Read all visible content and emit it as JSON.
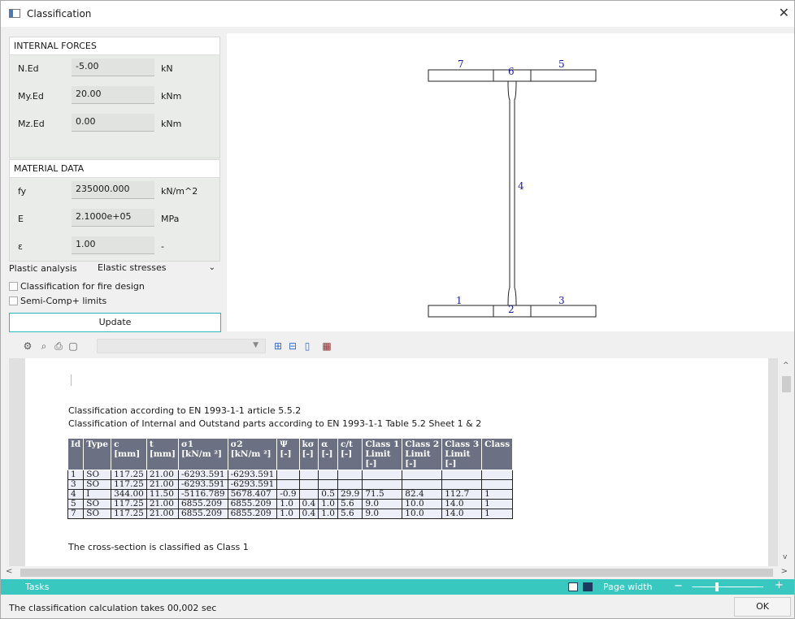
{
  "window": {
    "title": "Classification"
  },
  "forces": {
    "header": "INTERNAL FORCES",
    "rows": [
      {
        "label": "N.Ed",
        "value": "-5.00",
        "unit": "kN"
      },
      {
        "label": "My.Ed",
        "value": "20.00",
        "unit": "kNm"
      },
      {
        "label": "Mz.Ed",
        "value": "0.00",
        "unit": "kNm"
      }
    ]
  },
  "material": {
    "header": "MATERIAL DATA",
    "rows": [
      {
        "label": "fy",
        "value": "235000.000",
        "unit": "kN/m^2"
      },
      {
        "label": "E",
        "value": "2.1000e+05",
        "unit": "MPa"
      },
      {
        "label": "ε",
        "value": "1.00",
        "unit": "-"
      }
    ]
  },
  "plastic": {
    "label": "Plastic analysis",
    "value": "Elastic stresses"
  },
  "checks": {
    "fire": "Classification for fire design",
    "semi": "Semi-Comp+ limits"
  },
  "update_label": "Update",
  "diagram": {
    "labels": [
      "7",
      "6",
      "5",
      "4",
      "1",
      "2",
      "3"
    ]
  },
  "report": {
    "line1": "Classification  according to EN 1993-1-1 article 5.5.2",
    "line2": "Classification  of Internal and Outstand parts according to EN 1993-1-1 Table 5.2 Sheet 1 & 2",
    "conclusion": "The cross-section is classified  as Class 1",
    "headers": [
      [
        "Id"
      ],
      [
        "Type"
      ],
      [
        "c",
        "[mm]"
      ],
      [
        "t",
        "[mm]"
      ],
      [
        "σ1",
        "[kN/m ²]"
      ],
      [
        "σ2",
        "[kN/m ²]"
      ],
      [
        "Ψ",
        "[-]"
      ],
      [
        "kσ",
        "[-]"
      ],
      [
        "α",
        "[-]"
      ],
      [
        "c/t",
        "[-]"
      ],
      [
        "Class 1",
        "Limit",
        "[-]"
      ],
      [
        "Class 2",
        "Limit",
        "[-]"
      ],
      [
        "Class 3",
        "Limit",
        "[-]"
      ],
      [
        "Class"
      ]
    ],
    "rows": [
      [
        "1",
        "SO",
        "117.25",
        "21.00",
        "-6293.591",
        "-6293.591",
        "",
        "",
        "",
        "",
        "",
        "",
        "",
        ""
      ],
      [
        "3",
        "SO",
        "117.25",
        "21.00",
        "-6293.591",
        "-6293.591",
        "",
        "",
        "",
        "",
        "",
        "",
        "",
        ""
      ],
      [
        "4",
        "I",
        "344.00",
        "11.50",
        "-5116.789",
        "5678.407",
        "-0.9",
        "",
        "0.5",
        "29.9",
        "71.5",
        "82.4",
        "112.7",
        "1"
      ],
      [
        "5",
        "SO",
        "117.25",
        "21.00",
        "6855.209",
        "6855.209",
        "1.0",
        "0.4",
        "1.0",
        "5.6",
        "9.0",
        "10.0",
        "14.0",
        "1"
      ],
      [
        "7",
        "SO",
        "117.25",
        "21.00",
        "6855.209",
        "6855.209",
        "1.0",
        "0.4",
        "1.0",
        "5.6",
        "9.0",
        "10.0",
        "14.0",
        "1"
      ]
    ]
  },
  "tasks": {
    "label": "Tasks",
    "page_width": "Page width"
  },
  "status": {
    "text": "The classification calculation takes 00,002 sec"
  },
  "ok_label": "OK"
}
